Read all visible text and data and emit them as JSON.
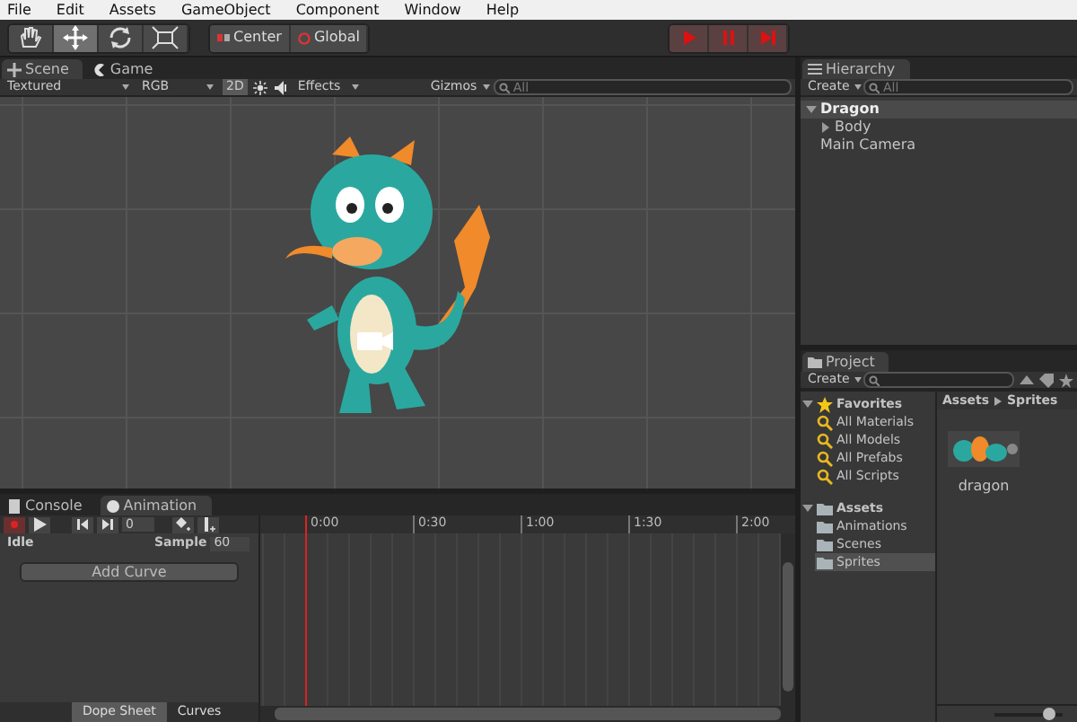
{
  "menu": [
    "File",
    "Edit",
    "Assets",
    "GameObject",
    "Component",
    "Window",
    "Help"
  ],
  "tools": [
    {
      "kind": "hand",
      "selected": false
    },
    {
      "kind": "move",
      "selected": true
    },
    {
      "kind": "rotate",
      "selected": false
    },
    {
      "kind": "scale",
      "selected": false
    }
  ],
  "pivot_buttons": [
    {
      "kind": "pivot",
      "label": "Center"
    },
    {
      "kind": "space",
      "label": "Global"
    }
  ],
  "playback": [
    {
      "kind": "play"
    },
    {
      "kind": "pause"
    },
    {
      "kind": "step"
    }
  ],
  "scene": {
    "tabs": [
      {
        "label": "Scene",
        "kind": "scene",
        "selected": true
      },
      {
        "label": "Game",
        "kind": "game",
        "selected": false
      }
    ],
    "toolbar": {
      "shading": "Textured",
      "channel": "RGB",
      "mode_2d": {
        "label": "2D",
        "on": true
      },
      "effects": "Effects",
      "gizmos": "Gizmos",
      "search_placeholder": "All"
    }
  },
  "hierarchy": {
    "title": "Hierarchy",
    "create": "Create",
    "search_placeholder": "All",
    "items": [
      {
        "label": "Dragon",
        "selected": true,
        "expanded": true,
        "children": [
          {
            "label": "Body",
            "selected": false,
            "expanded": false
          }
        ]
      },
      {
        "label": "Main Camera",
        "selected": false
      }
    ]
  },
  "project": {
    "title": "Project",
    "create": "Create",
    "tree": [
      {
        "label": "Favorites",
        "kind": "favorites",
        "selected": false,
        "expanded": true,
        "children": [
          {
            "label": "All Materials",
            "kind": "search",
            "selected": false
          },
          {
            "label": "All Models",
            "kind": "search",
            "selected": false
          },
          {
            "label": "All Prefabs",
            "kind": "search",
            "selected": false
          },
          {
            "label": "All Scripts",
            "kind": "search",
            "selected": false
          }
        ]
      },
      {
        "label": "Assets",
        "kind": "folder",
        "selected": false,
        "expanded": true,
        "children": [
          {
            "label": "Animations",
            "kind": "folder",
            "selected": false
          },
          {
            "label": "Scenes",
            "kind": "folder",
            "selected": false
          },
          {
            "label": "Sprites",
            "kind": "folder",
            "selected": true
          }
        ]
      }
    ],
    "breadcrumb": [
      "Assets",
      "Sprites"
    ],
    "assets": [
      {
        "label": "dragon"
      }
    ],
    "thumbnail_size": {
      "level": 0.8
    }
  },
  "animation": {
    "tabs": [
      {
        "label": "Console",
        "kind": "console",
        "selected": false
      },
      {
        "label": "Animation",
        "kind": "animation",
        "selected": true
      }
    ],
    "frame": "0",
    "clip": "Idle",
    "sample_label": "Sample",
    "sample": "60",
    "add_curve": "Add Curve",
    "ruler": [
      "0:00",
      "0:30",
      "1:00",
      "1:30",
      "2:00"
    ],
    "views": [
      {
        "label": "Dope Sheet",
        "selected": true
      },
      {
        "label": "Curves",
        "selected": false
      }
    ]
  }
}
